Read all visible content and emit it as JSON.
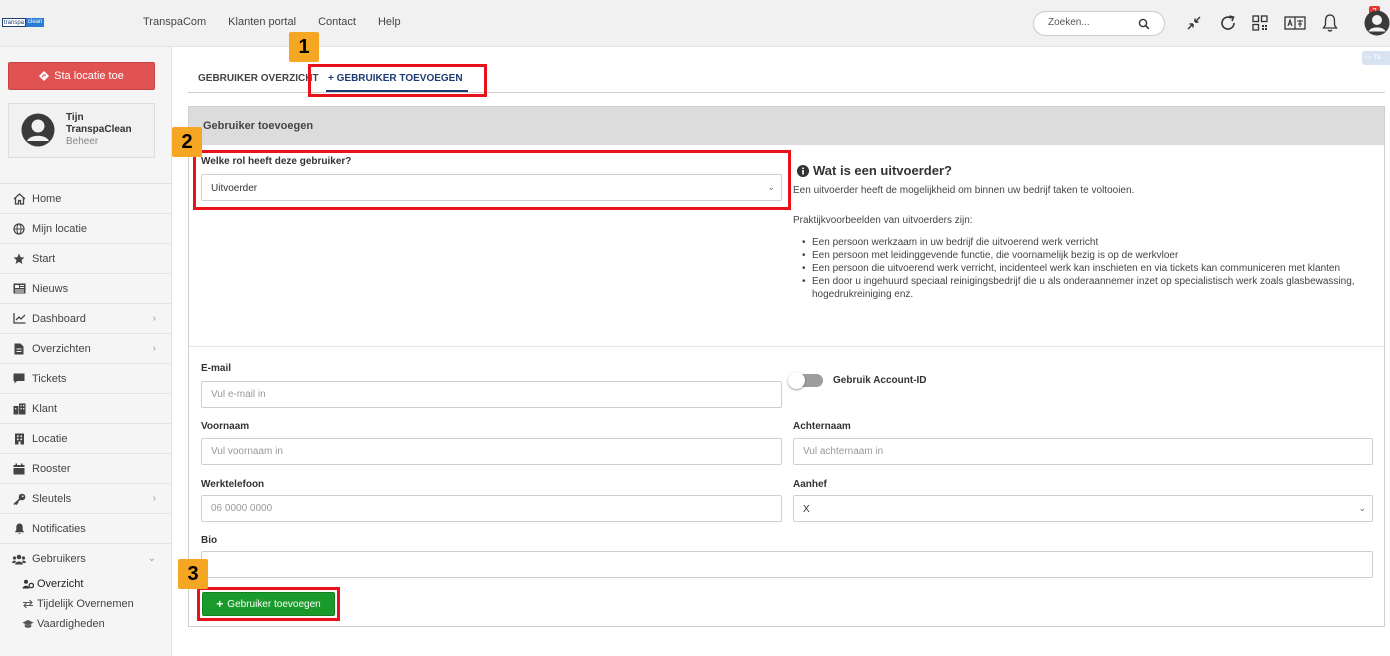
{
  "topbar": {
    "logo_left": "transpa",
    "logo_right": "clean",
    "nav": [
      "TranspaCom",
      "Klanten portal",
      "Contact",
      "Help"
    ],
    "search_placeholder": "Zoeken...",
    "notification_count": "2",
    "icons": [
      "compress-icon",
      "refresh-icon",
      "qr-code-icon",
      "translate-icon",
      "bell-icon",
      "user-avatar-icon"
    ]
  },
  "sidebar": {
    "sta_button": "Sta locatie toe",
    "user": {
      "name": "Tijn",
      "company": "TranspaClean",
      "role": "Beheer"
    },
    "items": [
      {
        "label": "Home",
        "icon": "home-icon"
      },
      {
        "label": "Mijn locatie",
        "icon": "globe-icon"
      },
      {
        "label": "Start",
        "icon": "star-icon"
      },
      {
        "label": "Nieuws",
        "icon": "newspaper-icon"
      },
      {
        "label": "Dashboard",
        "icon": "chart-icon",
        "chevron": "›"
      },
      {
        "label": "Overzichten",
        "icon": "file-icon",
        "chevron": "›"
      },
      {
        "label": "Tickets",
        "icon": "comment-icon"
      },
      {
        "label": "Klant",
        "icon": "building-icon"
      },
      {
        "label": "Locatie",
        "icon": "location-building-icon"
      },
      {
        "label": "Rooster",
        "icon": "calendar-icon"
      },
      {
        "label": "Sleutels",
        "icon": "key-icon",
        "chevron": "›"
      },
      {
        "label": "Notificaties",
        "icon": "bell-icon"
      },
      {
        "label": "Gebruikers",
        "icon": "users-icon",
        "chevron": "⌄"
      }
    ],
    "subitems": [
      {
        "label": "Overzicht",
        "icon": "users-cog-icon"
      },
      {
        "label": "Tijdelijk Overnemen",
        "icon": "exchange-icon"
      },
      {
        "label": "Vaardigheden",
        "icon": "graduation-cap-icon"
      }
    ]
  },
  "tabs": {
    "overview": "GEBRUIKER OVERZICHT",
    "add": "+ GEBRUIKER TOEVOEGEN"
  },
  "panel": {
    "title": "Gebruiker toevoegen",
    "role_label": "Welke rol heeft deze gebruiker?",
    "role_value": "Uitvoerder",
    "info_title": "Wat is een uitvoerder?",
    "info_text": "Een uitvoerder heeft de mogelijkheid om binnen uw bedrijf taken te voltooien.",
    "examples_title": "Praktijkvoorbeelden van uitvoerders zijn:",
    "examples": [
      "Een persoon werkzaam in uw bedrijf die uitvoerend werk verricht",
      "Een persoon met leidinggevende functie, die voornamelijk bezig is op de werkvloer",
      "Een persoon die uitvoerend werk verricht, incidenteel werk kan inschieten en via tickets kan communiceren met klanten",
      "Een door u ingehuurd speciaal reinigingsbedrijf die u als onderaannemer inzet op specialistisch werk zoals glasbewassing, hogedrukreiniging enz."
    ],
    "email_label": "E-mail",
    "email_placeholder": "Vul e-mail in",
    "account_id_label": "Gebruik Account-ID",
    "account_id_enabled": false,
    "firstname_label": "Voornaam",
    "firstname_placeholder": "Vul voornaam in",
    "lastname_label": "Achternaam",
    "lastname_placeholder": "Vul achternaam in",
    "phone_label": "Werktelefoon",
    "phone_placeholder": "06 0000 0000",
    "salutation_label": "Aanhef",
    "salutation_value": "X",
    "bio_label": "Bio",
    "submit": "Gebruiker toevoegen"
  },
  "annotations": [
    "1",
    "2",
    "3"
  ],
  "colors": {
    "accent": "#1c3c73",
    "danger": "#e15353",
    "success": "#1a9a2a",
    "highlight": "#e8121c",
    "badge": "#f5a623"
  }
}
